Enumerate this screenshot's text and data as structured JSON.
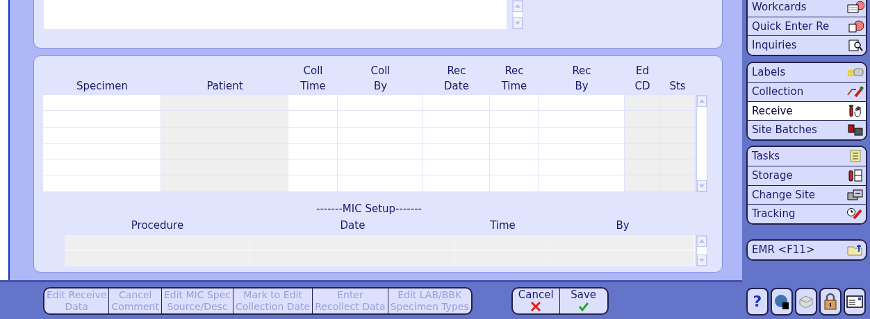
{
  "specimen_table": {
    "columns": [
      {
        "label": "Specimen",
        "kind": "editable"
      },
      {
        "label": "Patient",
        "kind": "readonly"
      },
      {
        "label": "Coll\nTime",
        "kind": "editable"
      },
      {
        "label": "Coll\nBy",
        "kind": "editable"
      },
      {
        "label": "Rec\nDate",
        "kind": "editable"
      },
      {
        "label": "Rec\nTime",
        "kind": "editable"
      },
      {
        "label": "Rec\nBy",
        "kind": "editable"
      },
      {
        "label": "Ed\nCD",
        "kind": "readonly"
      },
      {
        "label": "Sts",
        "kind": "readonly"
      }
    ]
  },
  "mic_setup": {
    "title": "-------MIC Setup-------",
    "columns": [
      "Procedure",
      "Date",
      "Time",
      "By"
    ]
  },
  "actions": [
    {
      "label": "Edit Receive\nData",
      "disabled": true
    },
    {
      "label": "Cancel\nComment",
      "disabled": true
    },
    {
      "label": "Edit MIC Spec\nSource/Desc",
      "disabled": true
    },
    {
      "label": "Mark to Edit\nCollection Date",
      "disabled": true
    },
    {
      "label": "Enter\nRecollect Data",
      "disabled": true
    },
    {
      "label": "Edit LAB/BBK\nSpecimen Types",
      "disabled": true
    }
  ],
  "confirm": [
    {
      "label": "Cancel",
      "kind": "cancel"
    },
    {
      "label": "Save",
      "kind": "save"
    }
  ],
  "sidebar": {
    "groups": [
      {
        "items": [
          {
            "label": "Workcards",
            "kind": "card",
            "selected": false
          },
          {
            "label": "Quick Enter Re",
            "kind": "quick",
            "selected": false
          },
          {
            "label": "Inquiries",
            "kind": "search",
            "selected": false
          }
        ]
      },
      {
        "items": [
          {
            "label": "Labels",
            "kind": "labels",
            "selected": false
          },
          {
            "label": "Collection",
            "kind": "collection",
            "selected": false
          },
          {
            "label": "Receive",
            "kind": "receive",
            "selected": true
          },
          {
            "label": "Site Batches",
            "kind": "batches",
            "selected": false
          }
        ]
      },
      {
        "items": [
          {
            "label": "Tasks",
            "kind": "tasks",
            "selected": false
          },
          {
            "label": "Storage",
            "kind": "storage",
            "selected": false
          },
          {
            "label": "Change Site",
            "kind": "site",
            "selected": false
          },
          {
            "label": "Tracking",
            "kind": "tracking",
            "selected": false
          }
        ]
      },
      {
        "items": [
          {
            "label": "EMR <F11>",
            "kind": "emr",
            "selected": false
          }
        ]
      }
    ],
    "tools": [
      {
        "kind": "help",
        "label": "?"
      },
      {
        "kind": "globe"
      },
      {
        "kind": "printer"
      },
      {
        "kind": "lock"
      },
      {
        "kind": "message"
      }
    ]
  }
}
